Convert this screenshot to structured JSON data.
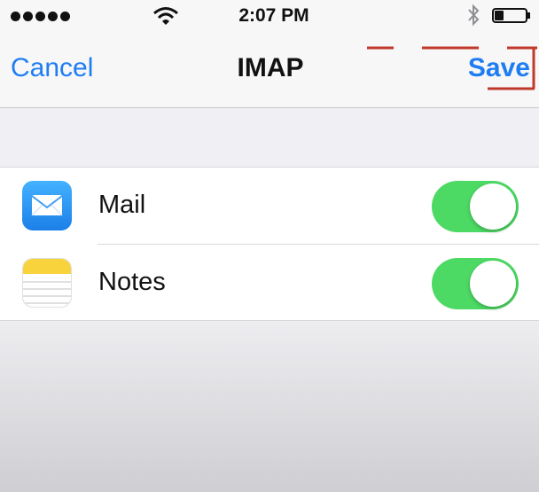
{
  "status_bar": {
    "signal_icon": "signal-dots-icon",
    "wifi_icon": "wifi-icon",
    "time": "2:07 PM",
    "bluetooth_icon": "bluetooth-icon",
    "battery_icon": "battery-icon",
    "battery_level": 0.3
  },
  "nav": {
    "cancel_label": "Cancel",
    "title": "IMAP",
    "save_label": "Save"
  },
  "accent_color": "#1e7df3",
  "toggle_on_color": "#4cd964",
  "annotation_color": "#c0392b",
  "items": [
    {
      "label": "Mail",
      "icon": "mail-icon",
      "enabled": true
    },
    {
      "label": "Notes",
      "icon": "notes-icon",
      "enabled": true
    }
  ]
}
